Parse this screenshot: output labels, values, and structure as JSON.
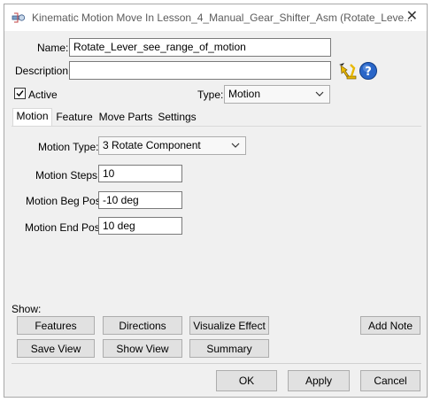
{
  "window": {
    "title": "Kinematic Motion Move In Lesson_4_Manual_Gear_Shifter_Asm (Rotate_Leve..."
  },
  "form": {
    "name_label": "Name:",
    "name_value": "Rotate_Lever_see_range_of_motion",
    "description_label": "Description:",
    "description_value": "",
    "active_label": "Active",
    "active_checked": true,
    "type_label": "Type:",
    "type_value": "Motion"
  },
  "tabs": [
    {
      "label": "Motion",
      "active": true
    },
    {
      "label": "Feature",
      "active": false
    },
    {
      "label": "Move Parts",
      "active": false
    },
    {
      "label": "Settings",
      "active": false
    }
  ],
  "motion": {
    "motion_type_label": "Motion Type:",
    "motion_type_value": "3 Rotate Component",
    "steps_label": "Motion Steps:",
    "steps_value": "10",
    "beg_label": "Motion Beg Pos:",
    "beg_value": "-10 deg",
    "end_label": "Motion End Pos:",
    "end_value": "10 deg"
  },
  "show": {
    "label": "Show:",
    "features": "Features",
    "directions": "Directions",
    "visualize_effect": "Visualize Effect",
    "add_note": "Add Note",
    "save_view": "Save View",
    "show_view": "Show View",
    "summary": "Summary"
  },
  "footer": {
    "ok": "OK",
    "apply": "Apply",
    "cancel": "Cancel"
  },
  "icons": {
    "app": "kinematic-app-icon",
    "close": "close-icon",
    "help": "help-icon",
    "pointer": "select-pointer-icon"
  },
  "colors": {
    "help_blue": "#1f5fbf",
    "pointer_yellow": "#e8b800"
  }
}
